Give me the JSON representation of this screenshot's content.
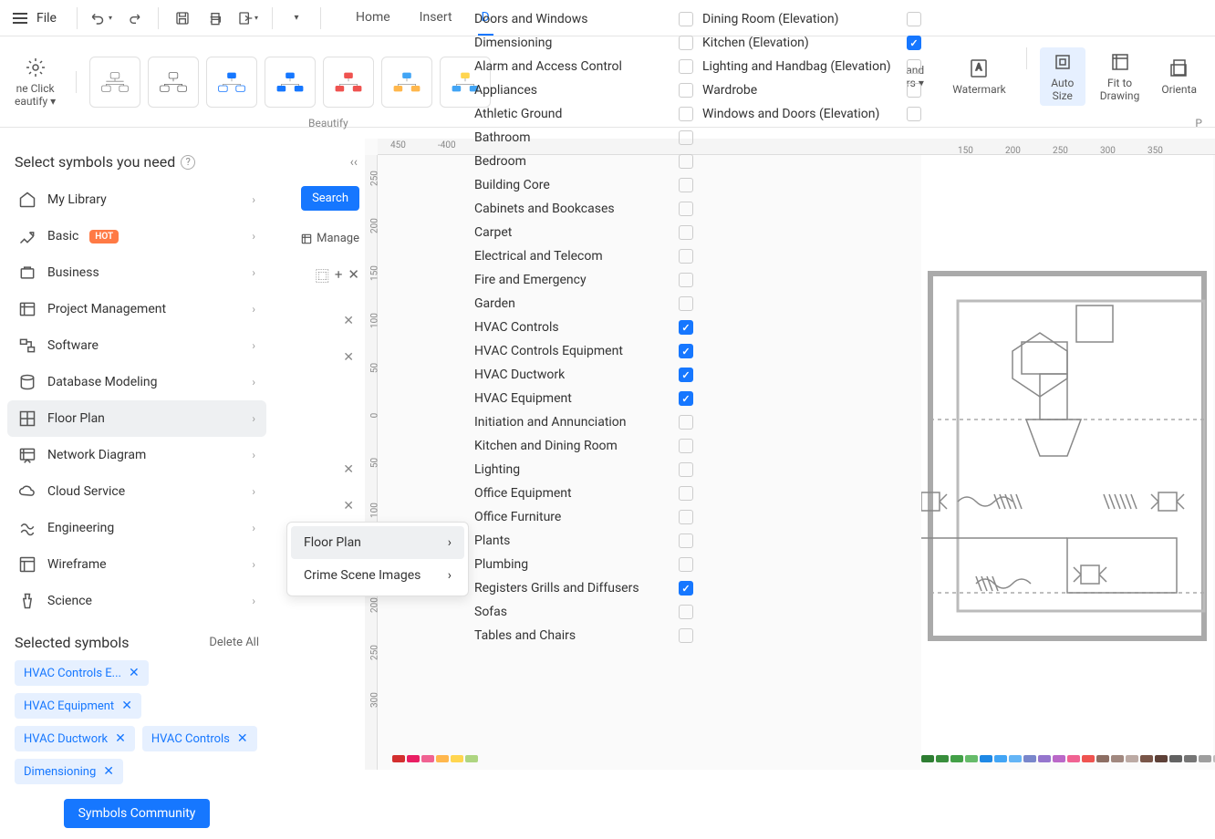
{
  "topbar": {
    "file": "File",
    "tabs": [
      "Home",
      "Insert",
      "D"
    ]
  },
  "ribbon": {
    "oneclick": "ne Click",
    "beautify": "eautify",
    "beautify_label": "Beautify",
    "right": {
      "and": "and",
      "ers": "rs",
      "watermark": "Watermark",
      "autosize1": "Auto",
      "autosize2": "Size",
      "fitto1": "Fit to",
      "fitto2": "Drawing",
      "orient": "Orienta"
    }
  },
  "sidebar": {
    "title": "Select symbols you need",
    "categories": [
      {
        "label": "My Library"
      },
      {
        "label": "Basic",
        "hot": true
      },
      {
        "label": "Business"
      },
      {
        "label": "Project Management"
      },
      {
        "label": "Software"
      },
      {
        "label": "Database Modeling"
      },
      {
        "label": "Floor Plan",
        "selected": true
      },
      {
        "label": "Network Diagram"
      },
      {
        "label": "Cloud Service"
      },
      {
        "label": "Engineering"
      },
      {
        "label": "Wireframe"
      },
      {
        "label": "Science"
      }
    ],
    "selected_title": "Selected symbols",
    "delete_all": "Delete All",
    "chips": [
      "HVAC Controls E...",
      "HVAC Equipment",
      "HVAC Ductwork",
      "HVAC Controls",
      "Dimensioning"
    ],
    "community": "Symbols Community"
  },
  "submenu": {
    "items": [
      {
        "label": "Floor Plan",
        "active": true
      },
      {
        "label": "Crime Scene Images"
      }
    ]
  },
  "midpanel": {
    "search": "Search",
    "manage": "Manage"
  },
  "checklist_col1": [
    {
      "label": "Doors and Windows",
      "checked": false
    },
    {
      "label": "Dimensioning",
      "checked": false
    },
    {
      "label": "Alarm and Access Control",
      "checked": false
    },
    {
      "label": "Appliances",
      "checked": false
    },
    {
      "label": "Athletic Ground",
      "checked": false
    },
    {
      "label": "Bathroom",
      "checked": false
    },
    {
      "label": "Bedroom",
      "checked": false
    },
    {
      "label": "Building Core",
      "checked": false
    },
    {
      "label": "Cabinets and Bookcases",
      "checked": false
    },
    {
      "label": "Carpet",
      "checked": false
    },
    {
      "label": "Electrical and Telecom",
      "checked": false
    },
    {
      "label": "Fire and Emergency",
      "checked": false
    },
    {
      "label": "Garden",
      "checked": false
    },
    {
      "label": "HVAC Controls",
      "checked": true
    },
    {
      "label": "HVAC Controls Equipment",
      "checked": true
    },
    {
      "label": "HVAC Ductwork",
      "checked": true
    },
    {
      "label": "HVAC Equipment",
      "checked": true
    },
    {
      "label": "Initiation and Annunciation",
      "checked": false
    },
    {
      "label": "Kitchen and Dining Room",
      "checked": false
    },
    {
      "label": "Lighting",
      "checked": false
    },
    {
      "label": "Office Equipment",
      "checked": false
    },
    {
      "label": "Office Furniture",
      "checked": false
    },
    {
      "label": "Plants",
      "checked": false
    },
    {
      "label": "Plumbing",
      "checked": false
    },
    {
      "label": "Registers Grills and Diffusers",
      "checked": true
    },
    {
      "label": "Sofas",
      "checked": false
    },
    {
      "label": "Tables and Chairs",
      "checked": false
    }
  ],
  "checklist_col2": [
    {
      "label": "Dining Room (Elevation)",
      "checked": false
    },
    {
      "label": "Kitchen (Elevation)",
      "checked": true
    },
    {
      "label": "Lighting and Handbag (Elevation)",
      "checked": false
    },
    {
      "label": "Wardrobe",
      "checked": false
    },
    {
      "label": "Windows and Doors (Elevation)",
      "checked": false
    }
  ],
  "ruler_h_left": [
    "450",
    "-400"
  ],
  "ruler_v_left": [
    "250",
    "200",
    "150",
    "100",
    "50",
    "0",
    "50",
    "100",
    "150",
    "200",
    "250",
    "300"
  ],
  "ruler_h_right": [
    "150",
    "200",
    "250",
    "300",
    "350"
  ],
  "colors": [
    "#d32f2f",
    "#e91e63",
    "#f06292",
    "#ffb74d",
    "#ffd54f",
    "#aed581"
  ],
  "colors_right": [
    "#2e7d32",
    "#388e3c",
    "#43a047",
    "#66bb6a",
    "#1e88e5",
    "#42a5f5",
    "#64b5f6",
    "#7986cb",
    "#9575cd",
    "#ba68c8",
    "#f06292",
    "#ef5350",
    "#8d6e63",
    "#a1887f",
    "#bcaaa4",
    "#795548",
    "#5d4037",
    "#616161",
    "#757575",
    "#9e9e9e",
    "#bdbdbd",
    "#1976d2",
    "#2196f3",
    "#64b5f6",
    "#90caf9",
    "#bbdefb"
  ]
}
